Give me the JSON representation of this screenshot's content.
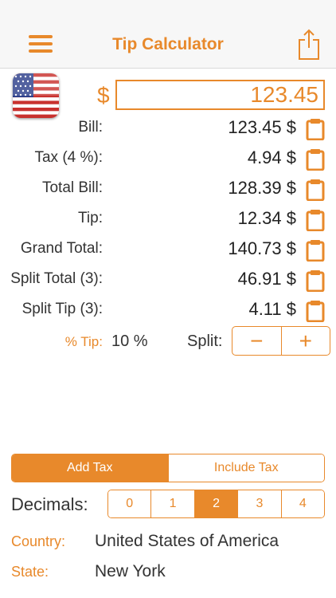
{
  "header": {
    "title": "Tip Calculator"
  },
  "input": {
    "currency_symbol": "$",
    "amount": "123.45"
  },
  "rows": [
    {
      "label": "Bill:",
      "value": "123.45 $"
    },
    {
      "label": "Tax (4 %):",
      "value": "4.94 $"
    },
    {
      "label": "Total Bill:",
      "value": "128.39 $"
    },
    {
      "label": "Tip:",
      "value": "12.34 $"
    },
    {
      "label": "Grand Total:",
      "value": "140.73 $"
    },
    {
      "label": "Split Total (3):",
      "value": "46.91 $"
    },
    {
      "label": "Split Tip (3):",
      "value": "4.11 $"
    }
  ],
  "tip": {
    "label": "% Tip:",
    "value": "10 %"
  },
  "split": {
    "label": "Split:",
    "minus": "−",
    "plus": "+"
  },
  "tax_mode": {
    "options": [
      "Add Tax",
      "Include Tax"
    ],
    "selected": 0
  },
  "decimals": {
    "label": "Decimals:",
    "options": [
      "0",
      "1",
      "2",
      "3",
      "4"
    ],
    "selected": 2
  },
  "location": {
    "country_label": "Country:",
    "country": "United States of America",
    "state_label": "State:",
    "state": "New York"
  },
  "colors": {
    "accent": "#e8892b",
    "text": "#333333",
    "navbar": "#f7f7f7"
  },
  "icons": {
    "menu": "hamburger-icon",
    "share": "share-icon",
    "copy": "clipboard-icon",
    "flag": "us-flag-icon"
  }
}
